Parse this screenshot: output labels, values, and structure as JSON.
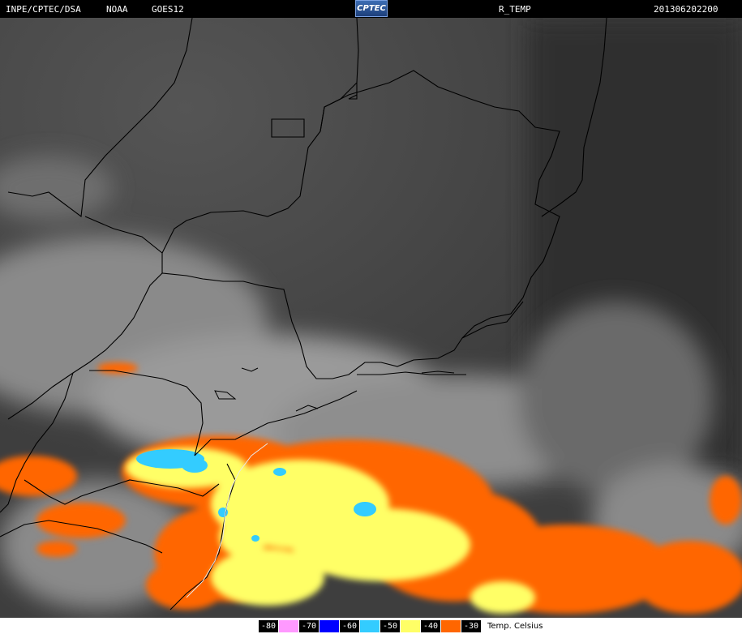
{
  "header": {
    "agency": "INPE/CPTEC/DSA",
    "source": "NOAA",
    "satellite": "GOES12",
    "logo_text": "CPTEC",
    "product": "R_TEMP",
    "datetime": "201306202200"
  },
  "legend": {
    "items": [
      {
        "label": "-80",
        "color": "#ff99ff"
      },
      {
        "label": "-70",
        "color": "#0000ff"
      },
      {
        "label": "-60",
        "color": "#33ccff"
      },
      {
        "label": "-50",
        "color": "#ffff66"
      },
      {
        "label": "-40",
        "color": "#ff6600"
      },
      {
        "label": "-30",
        "color": "#ffffff"
      }
    ],
    "unit": "Temp. Celsius"
  },
  "colors": {
    "cold_cloud_orange": "#ff6600",
    "cold_cloud_yellow": "#ffff66",
    "cold_cloud_cyan": "#33ccff",
    "borders": "#000000"
  }
}
